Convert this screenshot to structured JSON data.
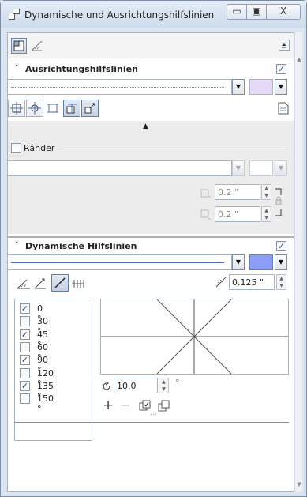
{
  "window": {
    "title": "Dynamische und Ausrichtungshilfslinien",
    "minimize_glyph": "▭",
    "restore_glyph": "▣",
    "close_glyph": "X",
    "title_icon": "window-doc-icon"
  },
  "toolbar": {
    "dock_icon": "dock-icon",
    "guides_icon": "guides-icon",
    "menu_icon": "panel-menu-icon"
  },
  "alignment": {
    "header": "Ausrichtungshilfslinien",
    "collapse_icon": "chevron-up-double-icon",
    "enabled": true,
    "enabled_glyph": "✓",
    "line_style_value": "",
    "color_hex": "#e6d9f6",
    "dropdown_glyph": "▼",
    "collapse_arrow": "▲",
    "modes": [
      "align-object-icon",
      "align-center-icon",
      "align-edges-icon",
      "align-snap-icon",
      "align-guides-icon"
    ],
    "page_icon": "page-icon",
    "margins": {
      "label": "Ränder",
      "checked": false,
      "style_value": "",
      "value_top": "0.2 \"",
      "value_bottom": "0.2 \"",
      "lock_icon": "lock-icon"
    }
  },
  "dynamic": {
    "header": "Dynamische Hilfslinien",
    "enabled": true,
    "line_style_value": "",
    "color_hex": "#8c9df7",
    "modes": [
      "dyn-angle-icon",
      "dyn-angle2-icon",
      "dyn-diagonal-icon",
      "dyn-ticks-icon"
    ],
    "spacing_icon": "tick-spacing-icon",
    "spacing_value": "0.125 \"",
    "angles": [
      {
        "label": "0 °",
        "checked": true
      },
      {
        "label": "30 °",
        "checked": false
      },
      {
        "label": "45 °",
        "checked": true
      },
      {
        "label": "60 °",
        "checked": false
      },
      {
        "label": "90 °",
        "checked": true
      },
      {
        "label": "120 °",
        "checked": false
      },
      {
        "label": "135 °",
        "checked": true
      },
      {
        "label": "150 °",
        "checked": false
      }
    ],
    "rotation_value": "10.0",
    "rotation_unit": "°",
    "add_glyph": "+",
    "remove_glyph": "—",
    "actions": [
      "copy-angles-icon",
      "duplicate-icon"
    ],
    "more_glyph": "..."
  }
}
